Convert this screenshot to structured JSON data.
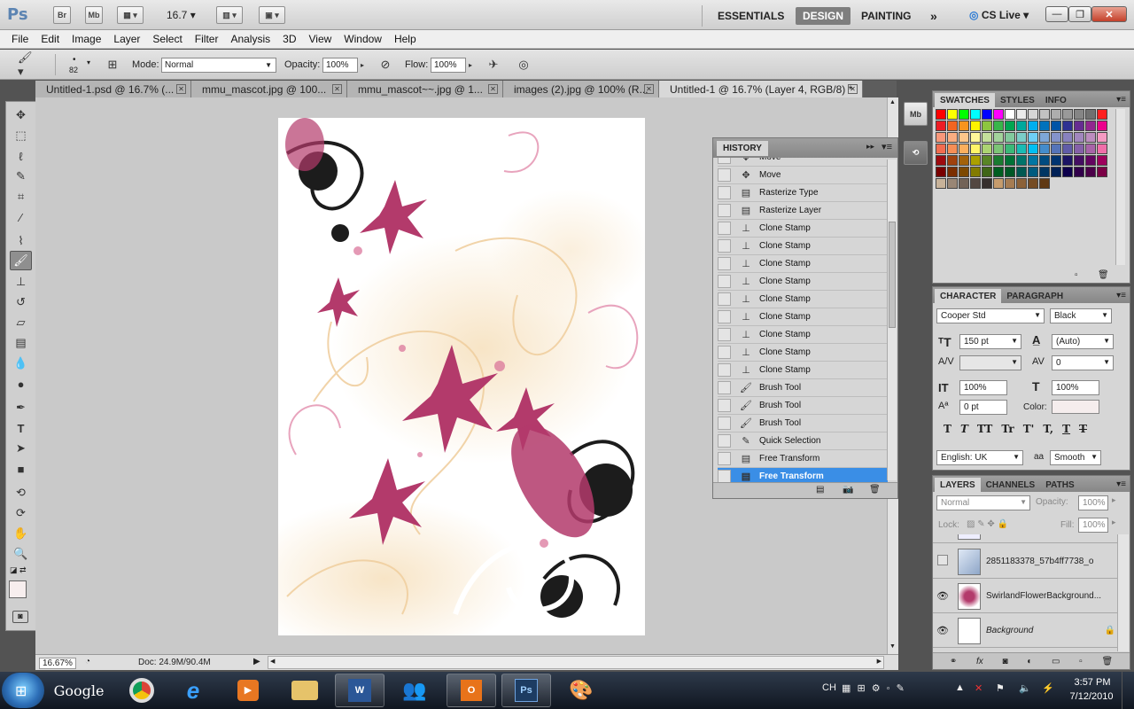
{
  "app": {
    "logo": "Ps",
    "bridge_btn": "Br",
    "minibridge_btn": "Mb",
    "zoom_value": "16.7",
    "workspaces": [
      "ESSENTIALS",
      "DESIGN",
      "PAINTING"
    ],
    "active_workspace": "DESIGN",
    "overflow": "»",
    "cslive": "CS Live"
  },
  "menu": [
    "File",
    "Edit",
    "Image",
    "Layer",
    "Select",
    "Filter",
    "Analysis",
    "3D",
    "View",
    "Window",
    "Help"
  ],
  "options": {
    "brush_size": "82",
    "mode_label": "Mode:",
    "mode_value": "Normal",
    "opacity_label": "Opacity:",
    "opacity_value": "100%",
    "flow_label": "Flow:",
    "flow_value": "100%"
  },
  "tabs": [
    {
      "label": "Untitled-1.psd @ 16.7% (..."
    },
    {
      "label": "mmu_mascot.jpg @ 100..."
    },
    {
      "label": "mmu_mascot~~.jpg @ 1..."
    },
    {
      "label": "images (2).jpg @ 100% (R..."
    },
    {
      "label": "Untitled-1 @ 16.7% (Layer 4, RGB/8) *"
    }
  ],
  "status": {
    "zoom": "16.67%",
    "doc": "Doc: 24.9M/90.4M"
  },
  "history": {
    "title": "HISTORY",
    "items": [
      {
        "label": "Move",
        "icon": "move-icon"
      },
      {
        "label": "Move",
        "icon": "move-icon"
      },
      {
        "label": "Rasterize Type",
        "icon": "document-icon"
      },
      {
        "label": "Rasterize Layer",
        "icon": "document-icon"
      },
      {
        "label": "Clone Stamp",
        "icon": "stamp-icon"
      },
      {
        "label": "Clone Stamp",
        "icon": "stamp-icon"
      },
      {
        "label": "Clone Stamp",
        "icon": "stamp-icon"
      },
      {
        "label": "Clone Stamp",
        "icon": "stamp-icon"
      },
      {
        "label": "Clone Stamp",
        "icon": "stamp-icon"
      },
      {
        "label": "Clone Stamp",
        "icon": "stamp-icon"
      },
      {
        "label": "Clone Stamp",
        "icon": "stamp-icon"
      },
      {
        "label": "Clone Stamp",
        "icon": "stamp-icon"
      },
      {
        "label": "Clone Stamp",
        "icon": "stamp-icon"
      },
      {
        "label": "Brush Tool",
        "icon": "brush-icon"
      },
      {
        "label": "Brush Tool",
        "icon": "brush-icon"
      },
      {
        "label": "Brush Tool",
        "icon": "brush-icon"
      },
      {
        "label": "Quick Selection",
        "icon": "quick-selection-icon"
      },
      {
        "label": "Free Transform",
        "icon": "document-icon"
      },
      {
        "label": "Free Transform",
        "icon": "document-icon"
      }
    ],
    "selected_index": 18
  },
  "swatches": {
    "tabs": [
      "SWATCHES",
      "STYLES",
      "INFO"
    ],
    "colors": [
      "#ff0000",
      "#ffff00",
      "#00ff00",
      "#00ffff",
      "#0000ff",
      "#ff00ff",
      "#ffffff",
      "#ebebeb",
      "#d6d6d6",
      "#c2c2c2",
      "#adadad",
      "#999999",
      "#858585",
      "#707070",
      "#ff1f1f",
      "#ed1c24",
      "#f26522",
      "#f7941d",
      "#fff200",
      "#8dc63f",
      "#39b54a",
      "#00a651",
      "#00a99d",
      "#00aeef",
      "#0072bc",
      "#0054a6",
      "#2e3192",
      "#662d91",
      "#92278f",
      "#ec008c",
      "#f7977a",
      "#f9ad81",
      "#fdc68a",
      "#fff799",
      "#c4df9b",
      "#a3d39c",
      "#82ca9d",
      "#7bcdc8",
      "#6ecff6",
      "#7ea7d8",
      "#8493ca",
      "#8882be",
      "#a187be",
      "#bc8dbf",
      "#f49ac2",
      "#f26c4f",
      "#f68e56",
      "#fbaf5d",
      "#fff568",
      "#acd372",
      "#7cc576",
      "#3bb878",
      "#1abbb4",
      "#00bff3",
      "#448ccb",
      "#5574b9",
      "#605ca8",
      "#8560a8",
      "#a864a8",
      "#f06ea9",
      "#9e0b0f",
      "#a0410d",
      "#a36209",
      "#aba000",
      "#598527",
      "#197b30",
      "#007236",
      "#00746b",
      "#0076a3",
      "#004b80",
      "#003471",
      "#1b1464",
      "#440e62",
      "#630460",
      "#9e005d",
      "#790000",
      "#7b2e00",
      "#7d4900",
      "#827b00",
      "#406618",
      "#005e20",
      "#005826",
      "#005952",
      "#005b7f",
      "#003663",
      "#002157",
      "#0d004c",
      "#32004b",
      "#4b0049",
      "#7b0046",
      "#c7b299",
      "#998675",
      "#736357",
      "#534741",
      "#362f2d",
      "#c69c6d",
      "#a67c52",
      "#8c6239",
      "#754c24",
      "#603913"
    ]
  },
  "character": {
    "tabs": [
      "CHARACTER",
      "PARAGRAPH"
    ],
    "font_family": "Cooper Std",
    "font_style": "Black",
    "font_size": "150 pt",
    "leading": "(Auto)",
    "kerning": "",
    "tracking": "0",
    "vscale": "100%",
    "hscale": "100%",
    "baseline": "0 pt",
    "color_label": "Color:",
    "language": "English: UK",
    "antialias_label": "aa",
    "antialias": "Smooth",
    "styles": [
      "T",
      "T",
      "TT",
      "Tr",
      "T'",
      "T,",
      "T",
      "T"
    ]
  },
  "layers": {
    "tabs": [
      "LAYERS",
      "CHANNELS",
      "PATHS"
    ],
    "blend": "Normal",
    "opacity_label": "Opacity:",
    "opacity": "100%",
    "lock_label": "Lock:",
    "fill_label": "Fill:",
    "fill": "100%",
    "items": [
      {
        "name": "2851183378_57b4ff7738_o",
        "visible": false
      },
      {
        "name": "SwirlandFlowerBackground...",
        "visible": true
      },
      {
        "name": "Background",
        "visible": true
      }
    ]
  },
  "taskbar": {
    "ime": "CH",
    "time": "3:57 PM",
    "date": "7/12/2010",
    "google": "Google"
  }
}
